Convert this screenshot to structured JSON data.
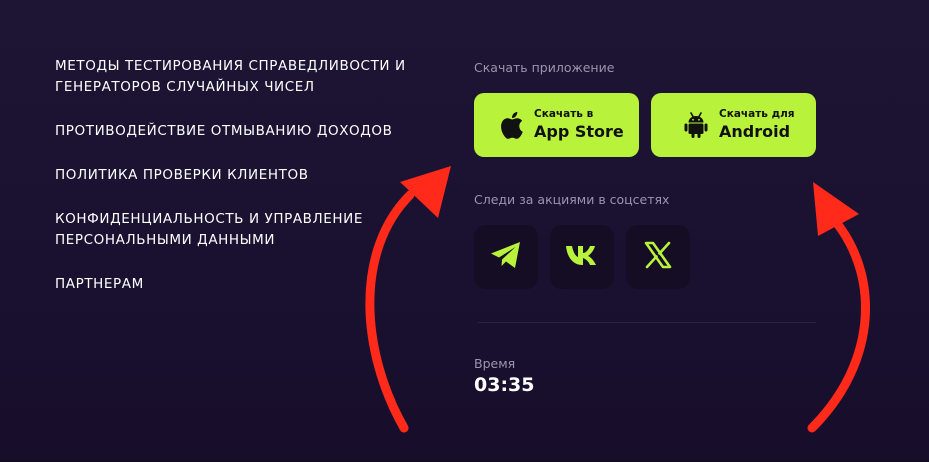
{
  "nav": {
    "links": [
      [
        "Методы тестирования справедливости и",
        "генераторов случайных чисел"
      ],
      [
        "Противодействие отмыванию доходов"
      ],
      [
        "Политика проверки клиентов"
      ],
      [
        "Конфиденциальность и управление",
        "персональными данными"
      ],
      [
        "Партнерам"
      ]
    ]
  },
  "download": {
    "label": "Скачать приложение",
    "apple": {
      "small": "Скачать в",
      "big": "App Store",
      "icon": "apple-icon"
    },
    "android": {
      "small": "Скачать для",
      "big": "Android",
      "icon": "android-icon"
    }
  },
  "social": {
    "label": "Следи за акциями в соцсетях",
    "items": [
      {
        "icon": "telegram-icon"
      },
      {
        "icon": "vk-icon"
      },
      {
        "icon": "x-icon"
      }
    ]
  },
  "time": {
    "label": "Время",
    "value": "03:35"
  },
  "colors": {
    "background": "#1b1230",
    "accent": "#b8f23b",
    "social_bg": "#140d24",
    "arrow": "#ff2a1a",
    "muted_text": "#9b94ae"
  }
}
